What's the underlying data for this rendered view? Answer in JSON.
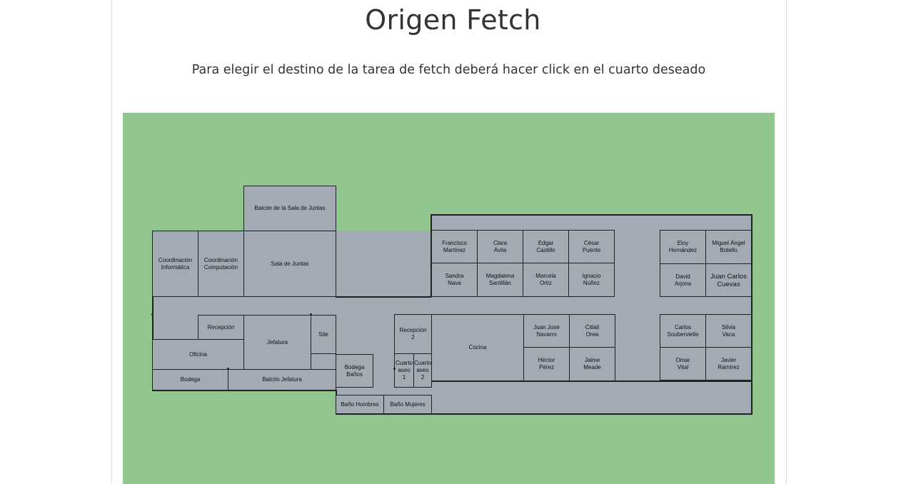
{
  "page": {
    "title": "Origen Fetch",
    "instructions": "Para elegir el destino de la tarea de fetch deberá hacer click en el cuarto deseado"
  },
  "colors": {
    "grass": "#90c68e",
    "floor": "#a2abb4",
    "walls": "#222222"
  },
  "rooms": {
    "balcon_sala_juntas": "Balcón de la Sala de Juntas",
    "coord_informatica": "Coordinación\nInformática",
    "coord_computacion": "Coordinación\nComputación",
    "sala_juntas": "Sala de Juntas",
    "recepcion": "Recepción",
    "jefatura": "Jefatura",
    "site": "Site",
    "oficina": "Oficina",
    "bodega": "Bodega",
    "balcon_jefatura": "Balcón Jefatura",
    "bodega_banos": "Bodega\nBaños",
    "recepcion_2": "Recepción\n2",
    "cuarto_aseo_1": "Cuarto\naseo\n1",
    "cuarto_aseo_2": "Cuarto\naseo\n2",
    "bano_hombres": "Baño Hombres",
    "bano_mujeres": "Baño Mujeres",
    "cocina": "Cocina",
    "francisco_martinez": "Francisco\nMartínez",
    "clara_avila": "Clara\nÁvila",
    "edgar_castillo": "Edgar\nCastillo",
    "cesar_puente": "César\nPuente",
    "sandra_nava": "Sandra\nNava",
    "magdalena_santillan": "Magdalena\nSantillán",
    "marcela_ortiz": "Marcela\nOrtiz",
    "ignacio_nunez": "Ignacio\nNúñez",
    "juan_jose_navarro": "Juan José\nNavarro",
    "citlali_orea": "Citlali\nOrea",
    "hector_perez": "Héctor\nPérez",
    "jaime_meade": "Jaime\nMeade",
    "eloy_hernandez": "Eloy\nHernández",
    "miguel_angel_botello": "Miguel Ángel\nBotello",
    "david_arjona": "David\nArjona",
    "juan_carlos_cuevas": "Juan Carlos\nCuevas",
    "carlos_soubervielle": "Carlos\nSoubervielle",
    "silvia_vaca": "Silvia\nVaca",
    "omar_vital": "Omar\nVital",
    "javier_ramirez": "Javier\nRamírez"
  }
}
